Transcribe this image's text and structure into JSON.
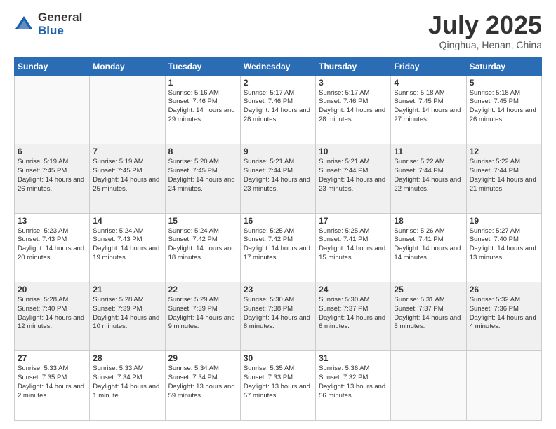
{
  "logo": {
    "general": "General",
    "blue": "Blue"
  },
  "title": "July 2025",
  "location": "Qinghua, Henan, China",
  "weekdays": [
    "Sunday",
    "Monday",
    "Tuesday",
    "Wednesday",
    "Thursday",
    "Friday",
    "Saturday"
  ],
  "weeks": [
    [
      {
        "day": "",
        "sunrise": "",
        "sunset": "",
        "daylight": ""
      },
      {
        "day": "",
        "sunrise": "",
        "sunset": "",
        "daylight": ""
      },
      {
        "day": "1",
        "sunrise": "Sunrise: 5:16 AM",
        "sunset": "Sunset: 7:46 PM",
        "daylight": "Daylight: 14 hours and 29 minutes."
      },
      {
        "day": "2",
        "sunrise": "Sunrise: 5:17 AM",
        "sunset": "Sunset: 7:46 PM",
        "daylight": "Daylight: 14 hours and 28 minutes."
      },
      {
        "day": "3",
        "sunrise": "Sunrise: 5:17 AM",
        "sunset": "Sunset: 7:46 PM",
        "daylight": "Daylight: 14 hours and 28 minutes."
      },
      {
        "day": "4",
        "sunrise": "Sunrise: 5:18 AM",
        "sunset": "Sunset: 7:45 PM",
        "daylight": "Daylight: 14 hours and 27 minutes."
      },
      {
        "day": "5",
        "sunrise": "Sunrise: 5:18 AM",
        "sunset": "Sunset: 7:45 PM",
        "daylight": "Daylight: 14 hours and 26 minutes."
      }
    ],
    [
      {
        "day": "6",
        "sunrise": "Sunrise: 5:19 AM",
        "sunset": "Sunset: 7:45 PM",
        "daylight": "Daylight: 14 hours and 26 minutes."
      },
      {
        "day": "7",
        "sunrise": "Sunrise: 5:19 AM",
        "sunset": "Sunset: 7:45 PM",
        "daylight": "Daylight: 14 hours and 25 minutes."
      },
      {
        "day": "8",
        "sunrise": "Sunrise: 5:20 AM",
        "sunset": "Sunset: 7:45 PM",
        "daylight": "Daylight: 14 hours and 24 minutes."
      },
      {
        "day": "9",
        "sunrise": "Sunrise: 5:21 AM",
        "sunset": "Sunset: 7:44 PM",
        "daylight": "Daylight: 14 hours and 23 minutes."
      },
      {
        "day": "10",
        "sunrise": "Sunrise: 5:21 AM",
        "sunset": "Sunset: 7:44 PM",
        "daylight": "Daylight: 14 hours and 23 minutes."
      },
      {
        "day": "11",
        "sunrise": "Sunrise: 5:22 AM",
        "sunset": "Sunset: 7:44 PM",
        "daylight": "Daylight: 14 hours and 22 minutes."
      },
      {
        "day": "12",
        "sunrise": "Sunrise: 5:22 AM",
        "sunset": "Sunset: 7:44 PM",
        "daylight": "Daylight: 14 hours and 21 minutes."
      }
    ],
    [
      {
        "day": "13",
        "sunrise": "Sunrise: 5:23 AM",
        "sunset": "Sunset: 7:43 PM",
        "daylight": "Daylight: 14 hours and 20 minutes."
      },
      {
        "day": "14",
        "sunrise": "Sunrise: 5:24 AM",
        "sunset": "Sunset: 7:43 PM",
        "daylight": "Daylight: 14 hours and 19 minutes."
      },
      {
        "day": "15",
        "sunrise": "Sunrise: 5:24 AM",
        "sunset": "Sunset: 7:42 PM",
        "daylight": "Daylight: 14 hours and 18 minutes."
      },
      {
        "day": "16",
        "sunrise": "Sunrise: 5:25 AM",
        "sunset": "Sunset: 7:42 PM",
        "daylight": "Daylight: 14 hours and 17 minutes."
      },
      {
        "day": "17",
        "sunrise": "Sunrise: 5:25 AM",
        "sunset": "Sunset: 7:41 PM",
        "daylight": "Daylight: 14 hours and 15 minutes."
      },
      {
        "day": "18",
        "sunrise": "Sunrise: 5:26 AM",
        "sunset": "Sunset: 7:41 PM",
        "daylight": "Daylight: 14 hours and 14 minutes."
      },
      {
        "day": "19",
        "sunrise": "Sunrise: 5:27 AM",
        "sunset": "Sunset: 7:40 PM",
        "daylight": "Daylight: 14 hours and 13 minutes."
      }
    ],
    [
      {
        "day": "20",
        "sunrise": "Sunrise: 5:28 AM",
        "sunset": "Sunset: 7:40 PM",
        "daylight": "Daylight: 14 hours and 12 minutes."
      },
      {
        "day": "21",
        "sunrise": "Sunrise: 5:28 AM",
        "sunset": "Sunset: 7:39 PM",
        "daylight": "Daylight: 14 hours and 10 minutes."
      },
      {
        "day": "22",
        "sunrise": "Sunrise: 5:29 AM",
        "sunset": "Sunset: 7:39 PM",
        "daylight": "Daylight: 14 hours and 9 minutes."
      },
      {
        "day": "23",
        "sunrise": "Sunrise: 5:30 AM",
        "sunset": "Sunset: 7:38 PM",
        "daylight": "Daylight: 14 hours and 8 minutes."
      },
      {
        "day": "24",
        "sunrise": "Sunrise: 5:30 AM",
        "sunset": "Sunset: 7:37 PM",
        "daylight": "Daylight: 14 hours and 6 minutes."
      },
      {
        "day": "25",
        "sunrise": "Sunrise: 5:31 AM",
        "sunset": "Sunset: 7:37 PM",
        "daylight": "Daylight: 14 hours and 5 minutes."
      },
      {
        "day": "26",
        "sunrise": "Sunrise: 5:32 AM",
        "sunset": "Sunset: 7:36 PM",
        "daylight": "Daylight: 14 hours and 4 minutes."
      }
    ],
    [
      {
        "day": "27",
        "sunrise": "Sunrise: 5:33 AM",
        "sunset": "Sunset: 7:35 PM",
        "daylight": "Daylight: 14 hours and 2 minutes."
      },
      {
        "day": "28",
        "sunrise": "Sunrise: 5:33 AM",
        "sunset": "Sunset: 7:34 PM",
        "daylight": "Daylight: 14 hours and 1 minute."
      },
      {
        "day": "29",
        "sunrise": "Sunrise: 5:34 AM",
        "sunset": "Sunset: 7:34 PM",
        "daylight": "Daylight: 13 hours and 59 minutes."
      },
      {
        "day": "30",
        "sunrise": "Sunrise: 5:35 AM",
        "sunset": "Sunset: 7:33 PM",
        "daylight": "Daylight: 13 hours and 57 minutes."
      },
      {
        "day": "31",
        "sunrise": "Sunrise: 5:36 AM",
        "sunset": "Sunset: 7:32 PM",
        "daylight": "Daylight: 13 hours and 56 minutes."
      },
      {
        "day": "",
        "sunrise": "",
        "sunset": "",
        "daylight": ""
      },
      {
        "day": "",
        "sunrise": "",
        "sunset": "",
        "daylight": ""
      }
    ]
  ]
}
